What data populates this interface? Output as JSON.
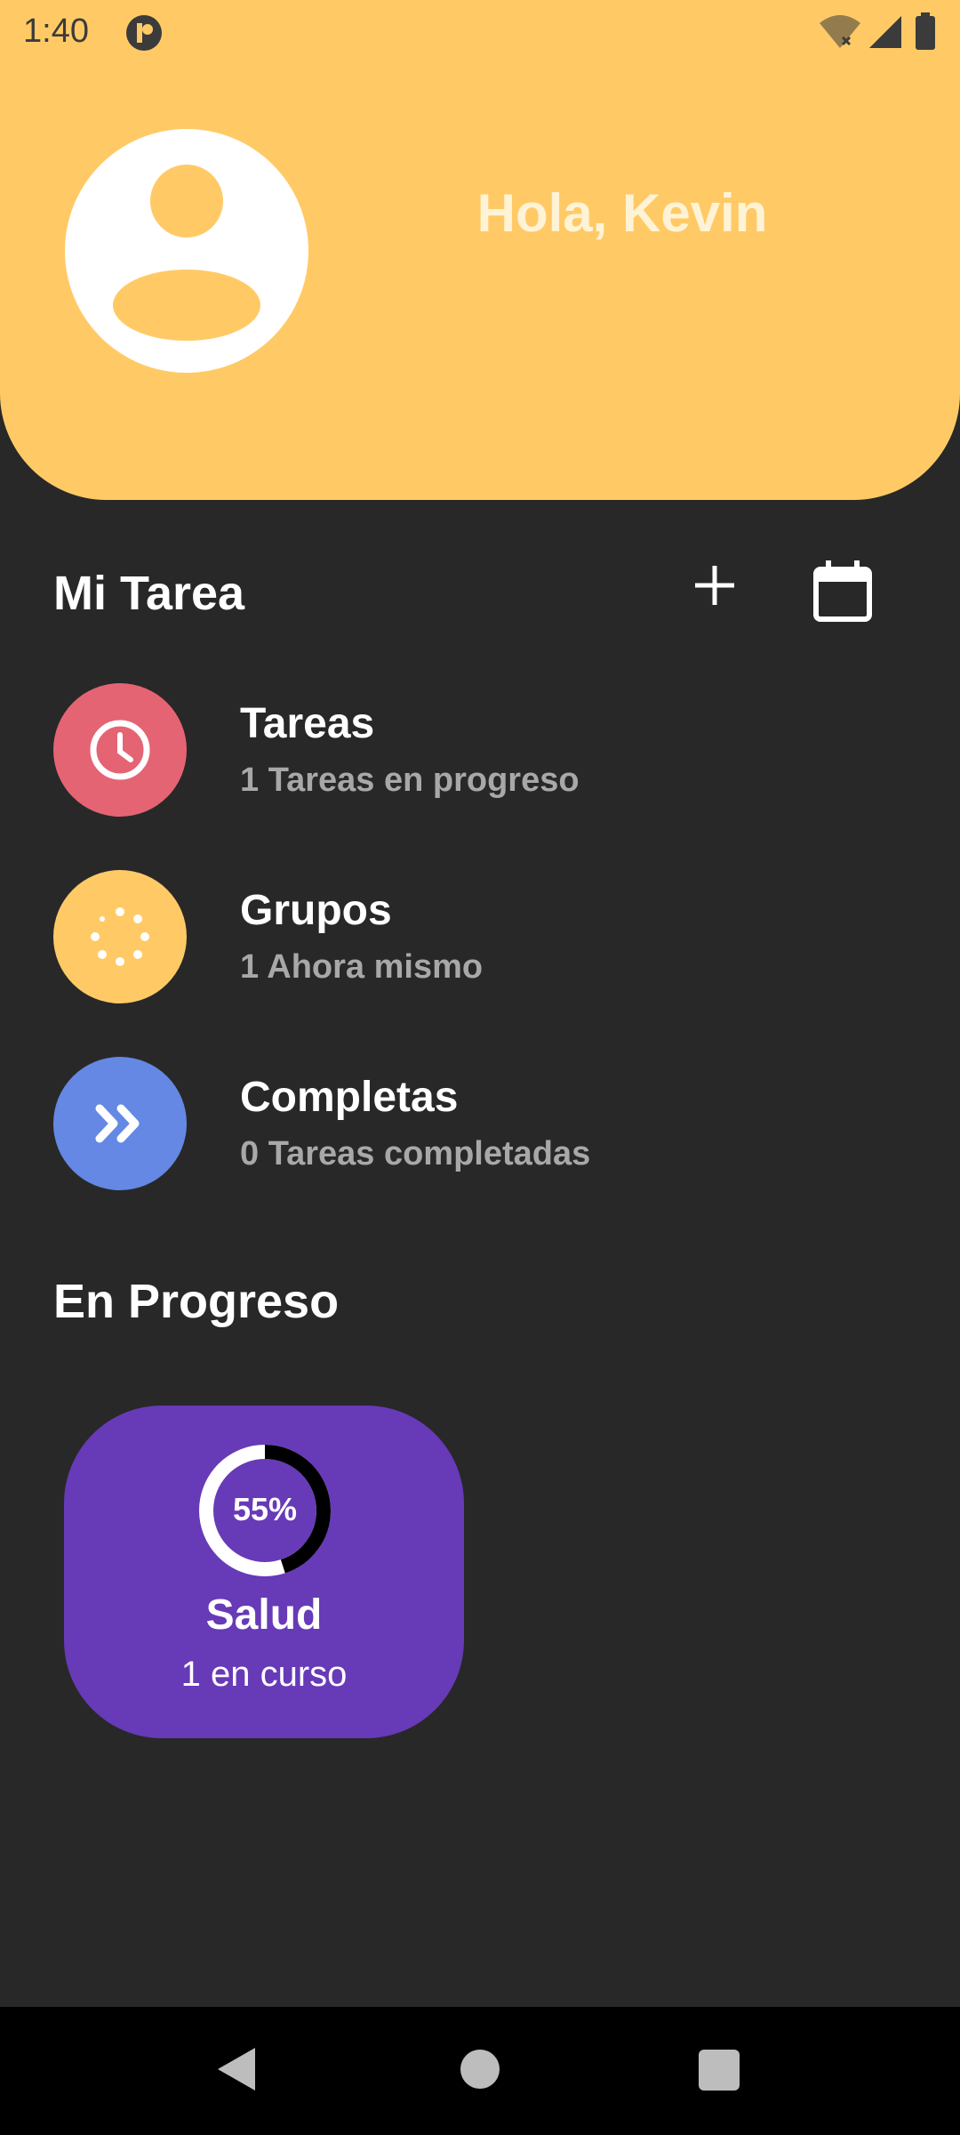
{
  "status_bar": {
    "time": "1:40"
  },
  "header": {
    "greeting": "Hola, Kevin",
    "background_color": "#FFCA66"
  },
  "my_tasks": {
    "title": "Mi Tarea",
    "items": [
      {
        "title": "Tareas",
        "subtitle": "1 Tareas en progreso",
        "icon": "clock-icon",
        "color": "#E56473"
      },
      {
        "title": "Grupos",
        "subtitle": "1 Ahora mismo",
        "icon": "loading-dots-icon",
        "color": "#FFCA66"
      },
      {
        "title": "Completas",
        "subtitle": "0 Tareas completadas",
        "icon": "double-chevron-right-icon",
        "color": "#6488E4"
      }
    ]
  },
  "in_progress": {
    "title": "En Progreso",
    "cards": [
      {
        "title": "Salud",
        "subtitle": "1 en curso",
        "percent_label": "55%",
        "progress": 0.55,
        "color": "#673AB7"
      }
    ]
  }
}
